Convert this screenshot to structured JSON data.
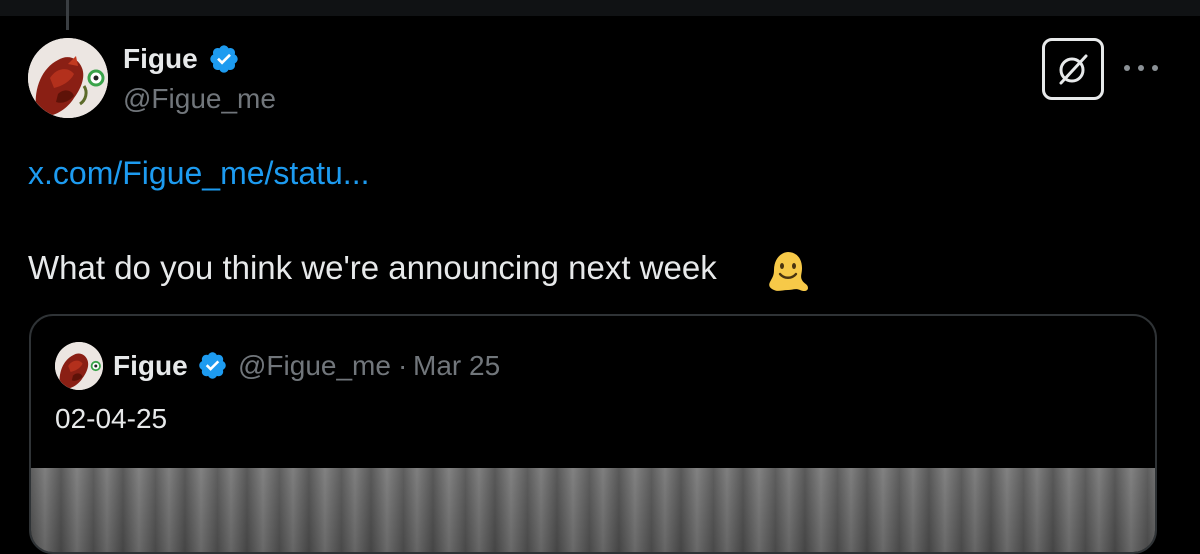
{
  "tweet": {
    "author_name": "Figue",
    "author_handle": "@Figue_me",
    "link_text": "x.com/Figue_me/statu...",
    "text": "What do you think we're announcing next week",
    "emoji_icon": "melting-face-emoji"
  },
  "quoted_tweet": {
    "author_name": "Figue",
    "author_handle": "@Figue_me",
    "separator": "·",
    "date": "Mar 25",
    "text": "02-04-25"
  },
  "icons": {
    "verified": "verified-badge-icon",
    "grok": "grok-icon",
    "more": "more-options-icon"
  },
  "colors": {
    "background": "#000000",
    "text_primary": "#e7e9ea",
    "text_secondary": "#71767b",
    "link": "#1d9bf0",
    "verified_badge": "#1d9bf0",
    "border": "#2f3336"
  }
}
